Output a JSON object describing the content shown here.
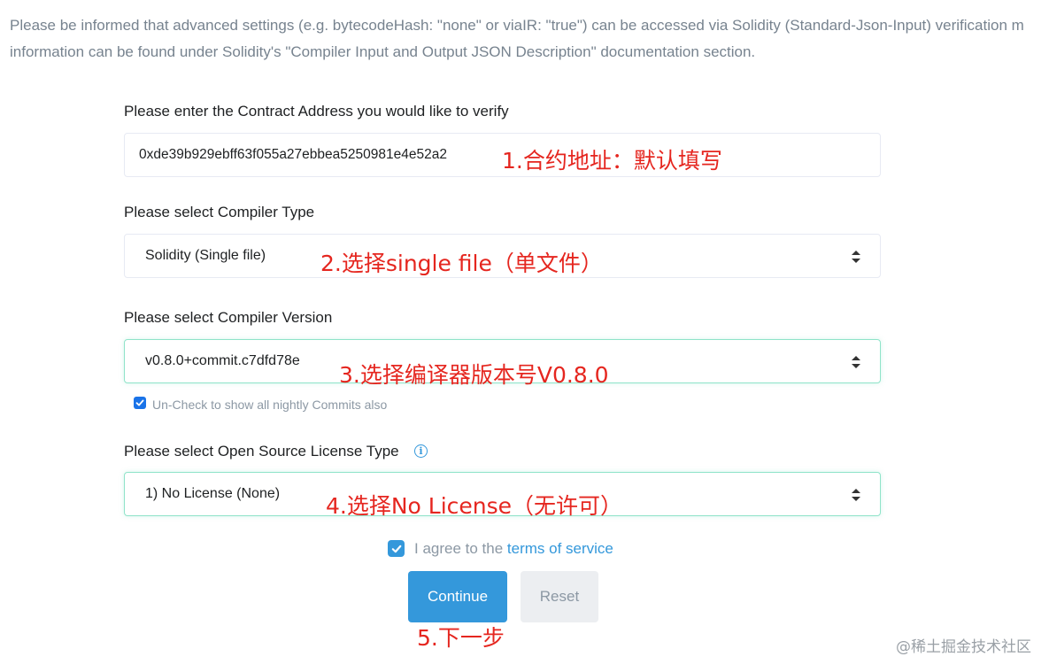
{
  "notice": {
    "line1": "Please be informed that advanced settings (e.g. bytecodeHash: \"none\" or viaIR: \"true\") can be accessed via Solidity (Standard-Json-Input) verification m",
    "line2": "information can be found under Solidity's \"Compiler Input and Output JSON Description\" documentation section."
  },
  "contract_address": {
    "label": "Please enter the Contract Address you would like to verify",
    "value": "0xde39b929ebff63f055a27ebbea5250981e4e52a2"
  },
  "compiler_type": {
    "label": "Please select Compiler Type",
    "selected": "Solidity (Single file)"
  },
  "compiler_version": {
    "label": "Please select Compiler Version",
    "selected": "v0.8.0+commit.c7dfd78e",
    "nightly_checkbox_label": "Un-Check to show all nightly Commits also",
    "nightly_checked": true
  },
  "license": {
    "label": "Please select Open Source License Type",
    "selected": "1) No License (None)"
  },
  "terms": {
    "prefix": "I agree to the ",
    "link": "terms of service",
    "checked": true
  },
  "buttons": {
    "continue": "Continue",
    "reset": "Reset"
  },
  "annotations": {
    "a1": "1.合约地址：默认填写",
    "a2": "2.选择single file（单文件）",
    "a3": "3.选择编译器版本号V0.8.0",
    "a4": "4.选择No License（无许可）",
    "a5": "5.下一步"
  },
  "watermark": "@稀土掘金技术社区",
  "icons": {
    "info": "info-icon",
    "check": "check-icon",
    "select_arrows": "select-arrows-icon"
  },
  "colors": {
    "primary": "#3498db",
    "annotation": "#e5261f",
    "muted_text": "#77838f",
    "focus_border": "#8fe3c9"
  }
}
